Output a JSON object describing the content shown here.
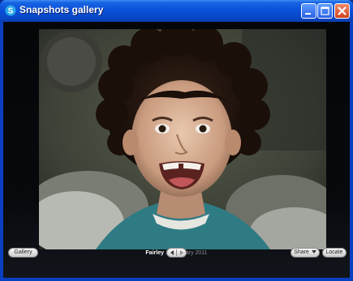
{
  "window": {
    "title": "Snapshots gallery",
    "colors": {
      "titlebar": "#0a4fd8",
      "close": "#d0421c",
      "background": "#07090d"
    }
  },
  "photo": {
    "caption_name": "Fairley",
    "caption_date": "26 January 2011"
  },
  "toolbar": {
    "gallery_label": "Gallery",
    "share_label": "Share",
    "locate_label": "Locate",
    "share_dropdown_icon": "chevron-down-icon",
    "nav_prev_icon": "arrow-left-icon",
    "nav_next_icon": "arrow-right-icon"
  }
}
